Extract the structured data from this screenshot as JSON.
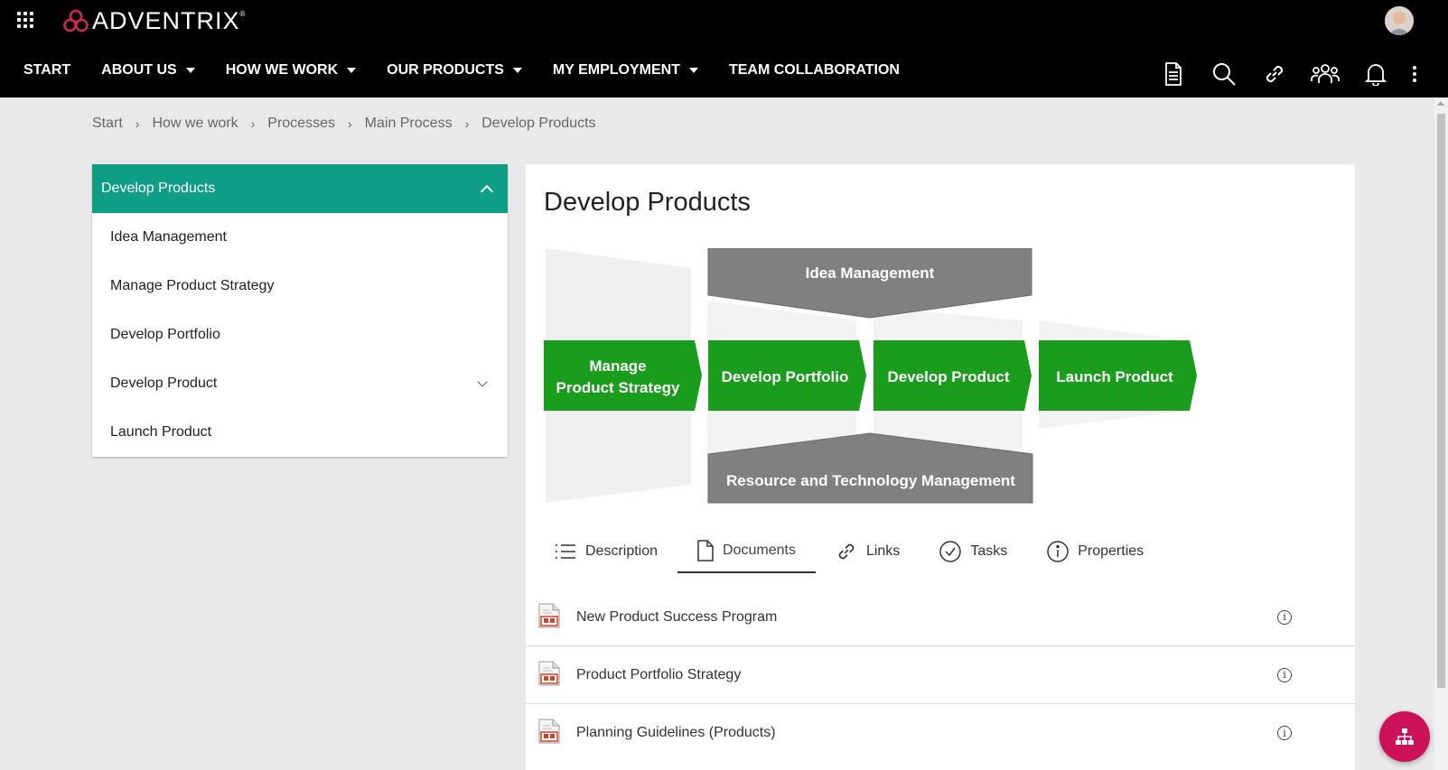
{
  "header": {
    "logo_text": "ADVENTRIX",
    "logo_mark": "®",
    "nav": [
      {
        "label": "START",
        "has_dropdown": false
      },
      {
        "label": "ABOUT US",
        "has_dropdown": true
      },
      {
        "label": "HOW WE WORK",
        "has_dropdown": true
      },
      {
        "label": "OUR PRODUCTS",
        "has_dropdown": true
      },
      {
        "label": "MY EMPLOYMENT",
        "has_dropdown": true
      },
      {
        "label": "TEAM COLLABORATION",
        "has_dropdown": false
      }
    ],
    "tool_icons": [
      "document-icon",
      "search-icon",
      "link-icon",
      "team-icon",
      "bell-icon",
      "more-icon"
    ]
  },
  "breadcrumb": [
    "Start",
    "How we work",
    "Processes",
    "Main Process",
    "Develop Products"
  ],
  "sidenav": {
    "title": "Develop Products",
    "items": [
      {
        "label": "Idea Management",
        "expandable": false
      },
      {
        "label": "Manage Product Strategy",
        "expandable": false
      },
      {
        "label": "Develop Portfolio",
        "expandable": false
      },
      {
        "label": "Develop Product",
        "expandable": true
      },
      {
        "label": "Launch Product",
        "expandable": false
      }
    ]
  },
  "main": {
    "title": "Develop Products",
    "diagram": {
      "top_box": "Idea Management",
      "bottom_box": "Resource and Technology Management",
      "steps": [
        {
          "line1": "Manage",
          "line2": "Product Strategy"
        },
        {
          "line1": "Develop Portfolio"
        },
        {
          "line1": "Develop Product"
        },
        {
          "line1": "Launch Product"
        }
      ]
    },
    "tabs": [
      {
        "label": "Description",
        "icon": "list-icon"
      },
      {
        "label": "Documents",
        "icon": "document-icon",
        "active": true
      },
      {
        "label": "Links",
        "icon": "link-icon"
      },
      {
        "label": "Tasks",
        "icon": "check-circle-icon"
      },
      {
        "label": "Properties",
        "icon": "info-icon"
      }
    ],
    "documents": [
      {
        "name": "New Product Success Program"
      },
      {
        "name": "Product Portfolio Strategy"
      },
      {
        "name": "Planning Guidelines (Products)"
      }
    ],
    "info_glyph": "i"
  },
  "colors": {
    "header_bg": "#000000",
    "accent_teal": "#0e9e86",
    "process_green": "#1a9c1d",
    "box_gray": "#808080",
    "fab_magenta": "#cc1158"
  }
}
